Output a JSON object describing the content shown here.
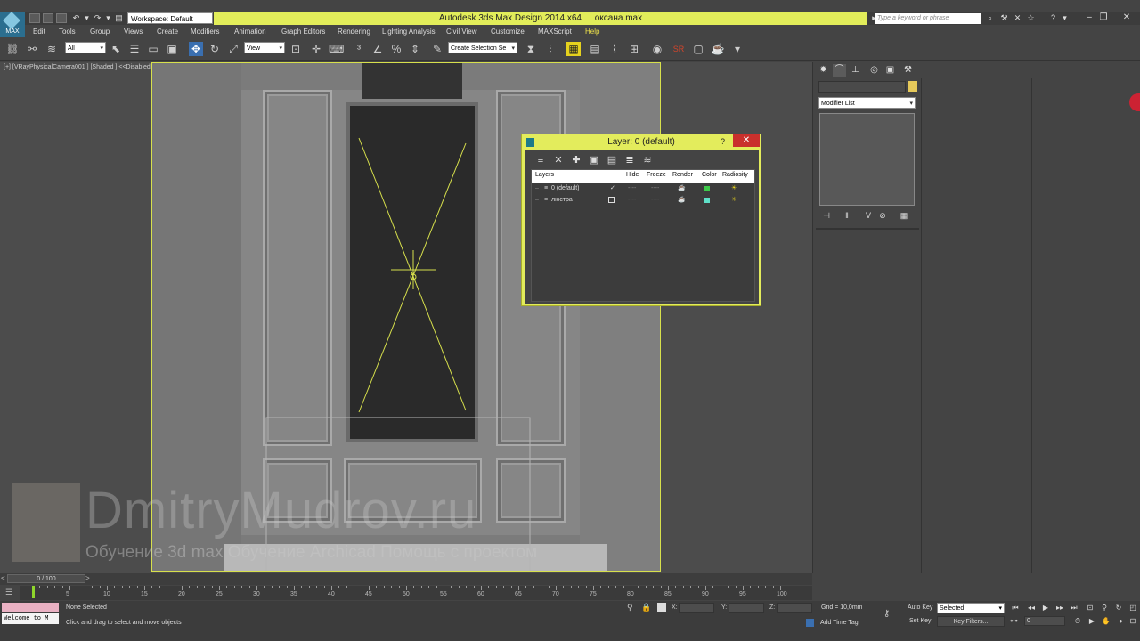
{
  "app": {
    "title": "Autodesk 3ds Max Design 2014 x64",
    "filename": "оксана.max",
    "workspace": "Workspace: Default",
    "logo_label": "MAX",
    "search_placeholder": "Type a keyword or phrase"
  },
  "menu": [
    "Edit",
    "Tools",
    "Group",
    "Views",
    "Create",
    "Modifiers",
    "Animation",
    "Graph Editors",
    "Rendering",
    "Lighting Analysis",
    "Civil View",
    "Customize",
    "MAXScript",
    "Help"
  ],
  "toolbar": {
    "filter_value": "All",
    "refcoord_value": "View",
    "selection_set_placeholder": "Create Selection Se"
  },
  "viewport": {
    "label": "[+] [VRayPhysicalCamera001 ] [Shaded ]  <<Disabled>>"
  },
  "watermark": {
    "title": "DmitryMudrov.ru",
    "subtitle": "Обучение 3d max   Обучение Archicad   Помощь с проектом"
  },
  "layer_dialog": {
    "title": "Layer: 0 (default)",
    "help": "?",
    "close": "✕",
    "columns": [
      "Layers",
      "Hide",
      "Freeze",
      "Render",
      "Color",
      "Radiosity"
    ],
    "rows": [
      {
        "name": "0 (default)",
        "active": "✓",
        "hide": "----",
        "freeze": "----",
        "color": "#3ec94a"
      },
      {
        "name": "люстра",
        "active": "",
        "hide": "----",
        "freeze": "----",
        "color": "#5fe0c8"
      }
    ]
  },
  "command_panel": {
    "modifier_list": "Modifier List"
  },
  "timeline": {
    "position": "0 / 100",
    "ticks": [
      5,
      10,
      15,
      20,
      25,
      30,
      35,
      40,
      45,
      50,
      55,
      60,
      65,
      70,
      75,
      80,
      85,
      90,
      95,
      100
    ]
  },
  "status": {
    "maxscript": "Welcome to M",
    "selection": "None Selected",
    "prompt": "Click and drag to select and move objects",
    "x_label": "X:",
    "y_label": "Y:",
    "z_label": "Z:",
    "grid": "Grid = 10,0mm",
    "add_time_tag": "Add Time Tag",
    "auto_key": "Auto Key",
    "set_key": "Set Key",
    "selected": "Selected",
    "key_filters": "Key Filters...",
    "frame": "0"
  }
}
